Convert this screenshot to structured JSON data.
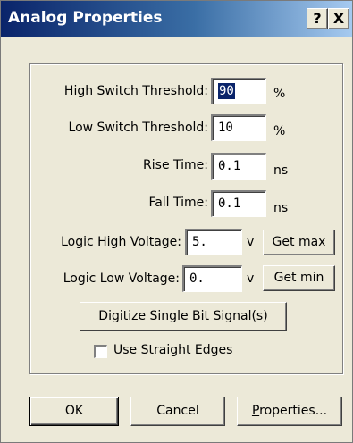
{
  "window": {
    "title": "Analog Properties",
    "help_label": "?",
    "close_label": "X"
  },
  "fields": {
    "high_switch": {
      "label": "High Switch Threshold:",
      "value": "90",
      "unit": "%"
    },
    "low_switch": {
      "label": "Low Switch Threshold:",
      "value": "10",
      "unit": "%"
    },
    "rise_time": {
      "label": "Rise Time:",
      "value": "0.1",
      "unit": "ns"
    },
    "fall_time": {
      "label": "Fall Time:",
      "value": "0.1",
      "unit": "ns"
    },
    "logic_high": {
      "label": "Logic High Voltage:",
      "value": "5.",
      "unit": "v",
      "button": "Get max"
    },
    "logic_low": {
      "label": "Logic Low Voltage:",
      "value": "0.",
      "unit": "v",
      "button": "Get min"
    }
  },
  "digitize_label": "Digitize Single Bit Signal(s)",
  "straight_edges": {
    "label_first": "U",
    "label_rest": "se Straight Edges",
    "checked": false
  },
  "footer": {
    "ok_label": "OK",
    "cancel_label": "Cancel",
    "properties_first": "P",
    "properties_rest": "roperties..."
  }
}
